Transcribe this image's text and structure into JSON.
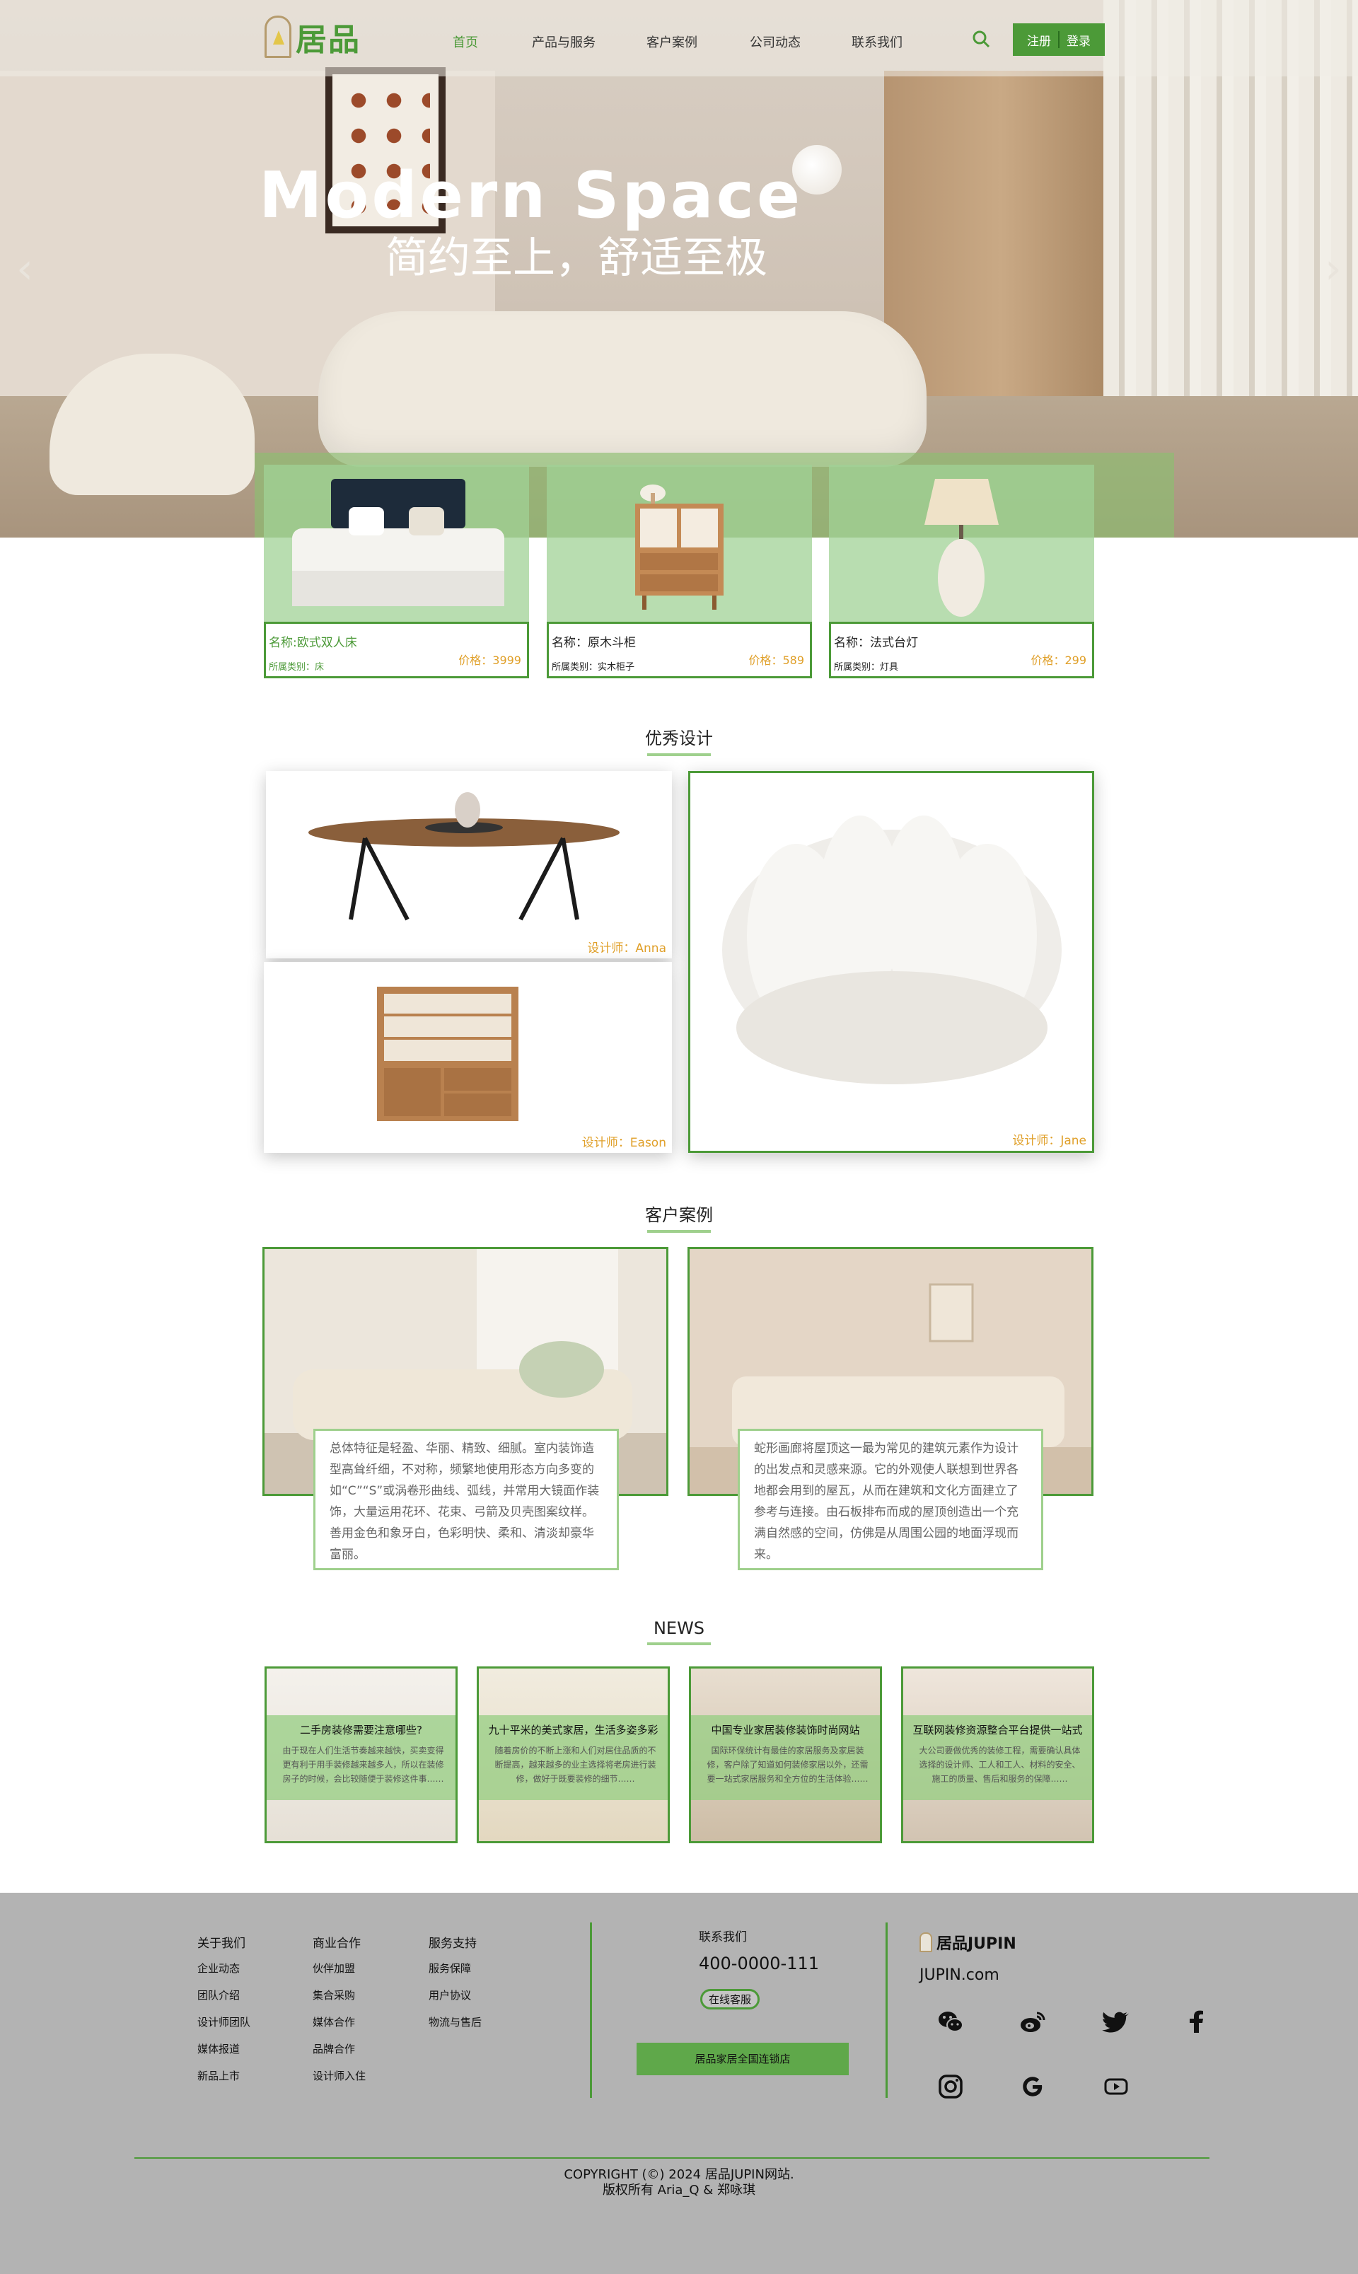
{
  "nav": {
    "logo_text": "居品",
    "items": [
      {
        "label": "首页",
        "active": true
      },
      {
        "label": "产品与服务"
      },
      {
        "label": "客户案例"
      },
      {
        "label": "公司动态"
      },
      {
        "label": "联系我们"
      }
    ],
    "register_label": "注册",
    "login_label": "登录",
    "accent_color": "#4c9a38"
  },
  "hero": {
    "title": "Modern  Space",
    "subtitle": "简约至上，舒适至极"
  },
  "products": [
    {
      "name": "名称:欧式双人床",
      "category": "所属类别：床",
      "price": "价格：3999"
    },
    {
      "name": "名称：原木斗柜",
      "category": "所属类别：实木柜子",
      "price": "价格：589"
    },
    {
      "name": "名称：法式台灯",
      "category": "所属类别：灯具",
      "price": "价格：299"
    }
  ],
  "design": {
    "title": "优秀设计",
    "items": [
      {
        "designer": "设计师：Anna"
      },
      {
        "designer": "设计师：Eason"
      },
      {
        "designer": "设计师：Jane"
      }
    ]
  },
  "cases": {
    "title": "客户案例",
    "items": [
      {
        "text": "总体特征是轻盈、华丽、精致、细腻。室内装饰造型高耸纤细，不对称，频繁地使用形态方向多变的如“C”“S”或涡卷形曲线、弧线，并常用大镜面作装饰，大量运用花环、花束、弓箭及贝壳图案纹样。善用金色和象牙白，色彩明快、柔和、清淡却豪华富丽。"
      },
      {
        "text": "蛇形画廊将屋顶这一最为常见的建筑元素作为设计的出发点和灵感来源。它的外观使人联想到世界各地都会用到的屋瓦，从而在建筑和文化方面建立了参考与连接。由石板排布而成的屋顶创造出一个充满自然感的空间，仿佛是从周围公园的地面浮现而来。"
      }
    ]
  },
  "news": {
    "title": "NEWS",
    "items": [
      {
        "title": "二手房装修需要注意哪些?",
        "desc": "由于现在人们生活节奏越来越快，买卖变得更有利于用手装修越来越多人，所以在装修房子的时候，会比较随便于装修这件事……"
      },
      {
        "title": "九十平米的美式家居，生活多姿多彩",
        "desc": "随着房价的不断上涨和人们对居住品质的不断提高，越来越多的业主选择将老房进行装修，做好于既要装修的细节……"
      },
      {
        "title": "中国专业家居装修装饰时尚网站",
        "desc": "国际环保统计有最佳的家居服务及家居装修，客户除了知道如何装修家居以外，还需要一站式家居服务和全方位的生活体验……"
      },
      {
        "title": "互联网装修资源整合平台提供一站式",
        "desc": "大公司要做优秀的装修工程，需要确认具体选择的设计师、工人和工人、材料的安全、施工的质量、售后和服务的保障……"
      }
    ]
  },
  "footer": {
    "col1": {
      "head": "关于我们",
      "items": [
        "企业动态",
        "团队介绍",
        "设计师团队",
        "媒体报道",
        "新品上市"
      ]
    },
    "col2": {
      "head": "商业合作",
      "items": [
        "伙伴加盟",
        "集合采购",
        "媒体合作",
        "品牌合作",
        "设计师入住"
      ]
    },
    "col3": {
      "head": "服务支持",
      "items": [
        "服务保障",
        "用户协议",
        "物流与售后"
      ]
    },
    "contact": {
      "head": "联系我们",
      "phone": "400-0000-111",
      "online_label": "在线客服",
      "stores_label": "居品家居全国连锁店"
    },
    "brand": {
      "name": "居品JUPIN",
      "domain": "JUPIN.com"
    },
    "social_icons": [
      "wechat-icon",
      "weibo-icon",
      "twitter-icon",
      "facebook-icon",
      "instagram-icon",
      "google-icon",
      "youtube-icon"
    ],
    "copyright_line1": "COPYRIGHT (©) 2024 居品JUPIN网站.",
    "copyright_line2": "版权所有 Aria_Q  &  郑咏琪"
  }
}
